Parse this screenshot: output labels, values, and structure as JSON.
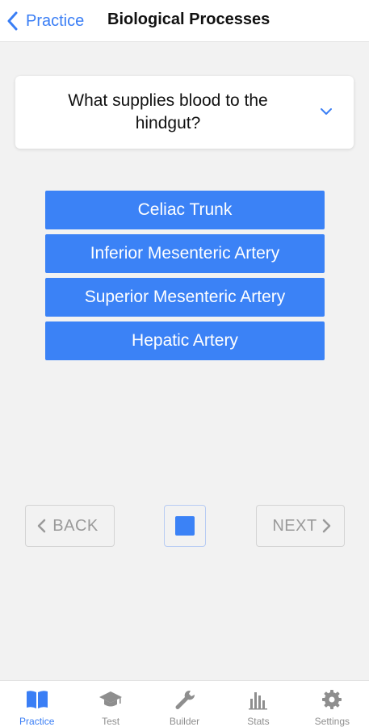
{
  "navbar": {
    "back_label": "Practice",
    "title": "Biological Processes"
  },
  "question": {
    "text": "What supplies blood to the hindgut?"
  },
  "answers": [
    {
      "label": "Celiac Trunk"
    },
    {
      "label": "Inferior Mesenteric Artery"
    },
    {
      "label": "Superior Mesenteric Artery"
    },
    {
      "label": "Hepatic Artery"
    }
  ],
  "controls": {
    "back_label": "BACK",
    "next_label": "NEXT"
  },
  "tabs": [
    {
      "label": "Practice",
      "icon": "book-icon",
      "active": true
    },
    {
      "label": "Test",
      "icon": "graduation-cap-icon",
      "active": false
    },
    {
      "label": "Builder",
      "icon": "wrench-icon",
      "active": false
    },
    {
      "label": "Stats",
      "icon": "bar-chart-icon",
      "active": false
    },
    {
      "label": "Settings",
      "icon": "gear-icon",
      "active": false
    }
  ],
  "colors": {
    "accent": "#3b82f6",
    "link": "#3a7ef5",
    "inactive": "#8e8e8e",
    "background": "#f2f2f2"
  }
}
